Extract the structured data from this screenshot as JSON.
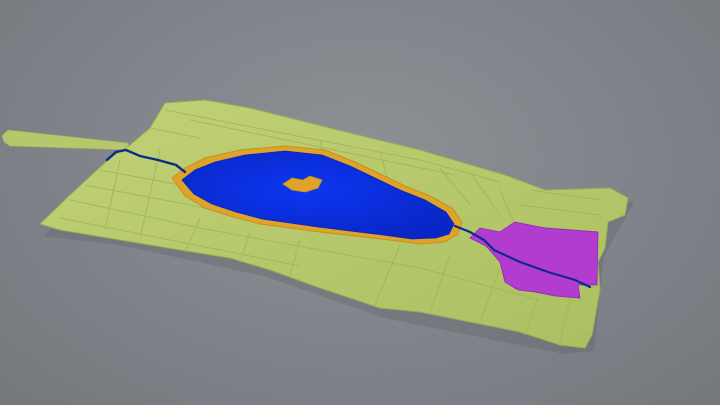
{
  "scene": {
    "background": "#84878b",
    "land_color": "#b9cb6d",
    "land_shadow_color": "#9fb05a",
    "water_color": "#0a2fe0",
    "shore_color": "#e0a32a",
    "zone_color": "#b23bd0",
    "channel_color": "#0b2a8a",
    "icons": {
      "terrain": "terrain-mesh",
      "lake": "lake-polygon",
      "island": "island-polygon",
      "zone": "purple-zone",
      "channel": "channel-line"
    }
  }
}
